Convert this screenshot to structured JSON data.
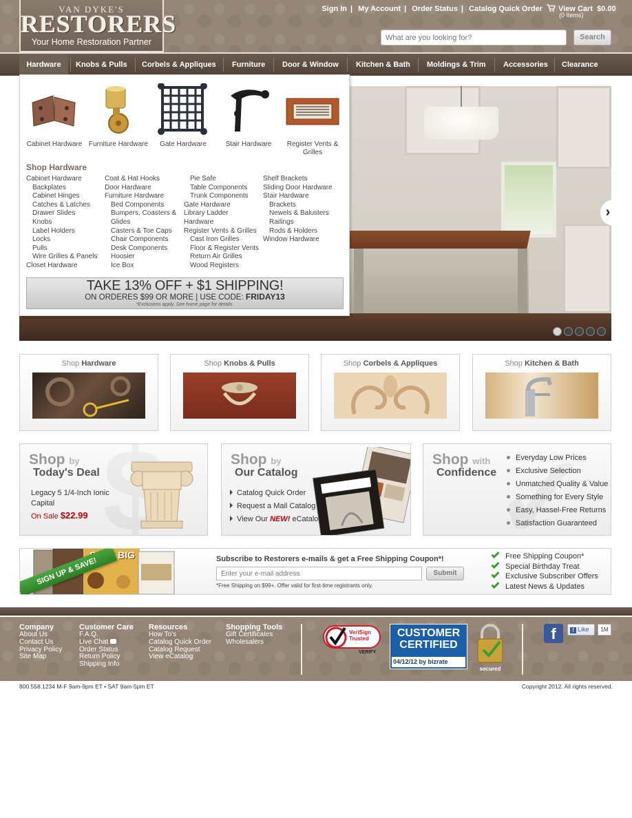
{
  "header": {
    "logo": {
      "brand_small": "VAN DYKE'S",
      "brand": "RESTORERS",
      "tagline": "Your Home Restoration Partner"
    },
    "top_links": [
      "Sign In",
      "My Account",
      "Order Status",
      "Catalog Quick Order"
    ],
    "cart": {
      "label": "View Cart",
      "amount": "$0.00",
      "items": "(0 Items)",
      "icon": "cart-icon"
    },
    "search": {
      "placeholder": "What are you looking for?",
      "button": "Search"
    }
  },
  "nav": {
    "items": [
      "Hardware",
      "Knobs & Pulls",
      "Corbels & Appliques",
      "Furniture",
      "Door & Window",
      "Kitchen & Bath",
      "Moldings & Trim",
      "Accessories",
      "Clearance"
    ],
    "active": "Hardware"
  },
  "dropdown": {
    "tiles": [
      "Cabinet Hardware",
      "Furniture Hardware",
      "Gate Hardware",
      "Stair Hardware",
      "Register Vents & Grilles"
    ],
    "heading": "Shop Hardware",
    "columns": [
      [
        {
          "text": "Cabinet Hardware",
          "indent": false
        },
        {
          "text": "Backplates",
          "indent": true
        },
        {
          "text": "Cabinet Hinges",
          "indent": true
        },
        {
          "text": "Catches & Latches",
          "indent": true
        },
        {
          "text": "Drawer Slides",
          "indent": true
        },
        {
          "text": "Knobs",
          "indent": true
        },
        {
          "text": "Label Holders",
          "indent": true
        },
        {
          "text": "Locks",
          "indent": true
        },
        {
          "text": "Pulls",
          "indent": true
        },
        {
          "text": "Wire Grilles & Panels",
          "indent": true
        },
        {
          "text": "Closet Hardware",
          "indent": false
        }
      ],
      [
        {
          "text": "Coat & Hat Hooks",
          "indent": false
        },
        {
          "text": "Door Hardware",
          "indent": false
        },
        {
          "text": "Furniture Hardware",
          "indent": false
        },
        {
          "text": "Bed Components",
          "indent": true
        },
        {
          "text": "Bumpers, Coasters &",
          "indent": true
        },
        {
          "text": "Glides",
          "indent": true
        },
        {
          "text": "Casters & Toe Caps",
          "indent": true
        },
        {
          "text": "Chair Components",
          "indent": true
        },
        {
          "text": "Desk Components",
          "indent": true
        },
        {
          "text": "Hoosier",
          "indent": true
        },
        {
          "text": "Ice Box",
          "indent": true
        }
      ],
      [
        {
          "text": "Pie Safe",
          "indent": true
        },
        {
          "text": "Table Components",
          "indent": true
        },
        {
          "text": "Trunk Components",
          "indent": true
        },
        {
          "text": "Gate Hardware",
          "indent": false
        },
        {
          "text": "Library Ladder",
          "indent": false
        },
        {
          "text": "Hardware",
          "indent": false
        },
        {
          "text": "Register Vents & Grilles",
          "indent": false
        },
        {
          "text": "Cast Iron Grilles",
          "indent": true
        },
        {
          "text": "Floor & Register Vents",
          "indent": true
        },
        {
          "text": "Return Air Grilles",
          "indent": true
        },
        {
          "text": "Wood Registers",
          "indent": true
        }
      ],
      [
        {
          "text": "Shelf Brackets",
          "indent": false
        },
        {
          "text": "Sliding Door Hardware",
          "indent": false
        },
        {
          "text": "Stair Hardware",
          "indent": false
        },
        {
          "text": "Brackets",
          "indent": true
        },
        {
          "text": "Newels & Balusters",
          "indent": true
        },
        {
          "text": "Railings",
          "indent": true
        },
        {
          "text": "Rods & Holders",
          "indent": true
        },
        {
          "text": "Window Hardware",
          "indent": false
        }
      ]
    ],
    "promo": {
      "line1": "TAKE 13% OFF + $1 SHIPPING!",
      "line2_a": "ON ORDERES $99 OR MORE | USE CODE:",
      "code": "FRIDAY13",
      "line3": "*Exclusions apply. See home page for details."
    }
  },
  "hero": {
    "slides": 5,
    "active_slide": 1,
    "next": "›"
  },
  "categories": [
    {
      "prefix": "Shop",
      "name": "Hardware"
    },
    {
      "prefix": "Shop",
      "name": "Knobs & Pulls"
    },
    {
      "prefix": "Shop",
      "name": "Corbels & Appliques"
    },
    {
      "prefix": "Shop",
      "name": "Kitchen & Bath"
    }
  ],
  "deal": {
    "shop": "Shop",
    "by": "by",
    "title": "Today's Deal",
    "product": "Legacy 5 1/4-Inch Ionic Capital",
    "sale_label": "On Sale",
    "price": "$22.99"
  },
  "catalog": {
    "shop": "Shop",
    "by": "by",
    "title": "Our Catalog",
    "links": [
      "Catalog Quick Order",
      "Request a Mail Catalog"
    ],
    "ecatalog": {
      "pre": "View Our",
      "new": "NEW!",
      "post": "eCatalog"
    }
  },
  "confidence": {
    "shop": "Shop",
    "with": "with",
    "title": "Confidence",
    "items": [
      "Everyday Low Prices",
      "Exclusive Selection",
      "Unmatched Quality & Value",
      "Something for Every Style",
      "Easy, Hassel-Free Returns",
      "Satisfaction Guaranteed"
    ]
  },
  "subscribe": {
    "banner": "SIGN UP & SAVE!",
    "save_big": "SAVE BIG",
    "title": "Subscribe to Restorers e-mails & get a Free Shipping Coupon*!",
    "placeholder": "Enter your e-mail address",
    "button": "Submit",
    "note": "*Free Shipping on $99+. Offer valid for first-time registrants only.",
    "checks": [
      "Free Shipping Coupon*",
      "Special Birthday Treat",
      "Exclusive Subscriber Offers",
      "Latest News & Updates"
    ]
  },
  "footer": {
    "columns": [
      {
        "heading": "Company",
        "links": [
          "About Us",
          "Contact Us",
          "Privacy Policy",
          "Site Map"
        ]
      },
      {
        "heading": "Customer Care",
        "links": [
          "F.A.Q.",
          "Live Chat",
          "Order Status",
          "Return Policy",
          "Shipping Info"
        ]
      },
      {
        "heading": "Resources",
        "links": [
          "How To's",
          "Catalog Quick Order",
          "Catalog Request",
          "View eCatalog"
        ]
      },
      {
        "heading": "Shopping Tools",
        "links": [
          "Gift Certificates",
          "Wholesalers"
        ]
      }
    ],
    "verisign": {
      "line1": "VeriSign",
      "line2": "Trusted",
      "verify": "VERIFY"
    },
    "bizrate": {
      "line1": "CUSTOMER",
      "line2": "CERTIFIED",
      "date": "04/12/12 by bizrate"
    },
    "secured": "secured",
    "like": "Like",
    "like_count": "1M",
    "phone": "800.558.1234  M-F 9am-9pm ET • SAT 9am-5pm ET",
    "copyright": "Copyright 2012.  All rights reserved."
  },
  "colors": {
    "brand_brown": "#8f7f70",
    "nav_dark": "#4f4238",
    "sale_red": "#c00000",
    "check_green": "#3b9e2d"
  }
}
